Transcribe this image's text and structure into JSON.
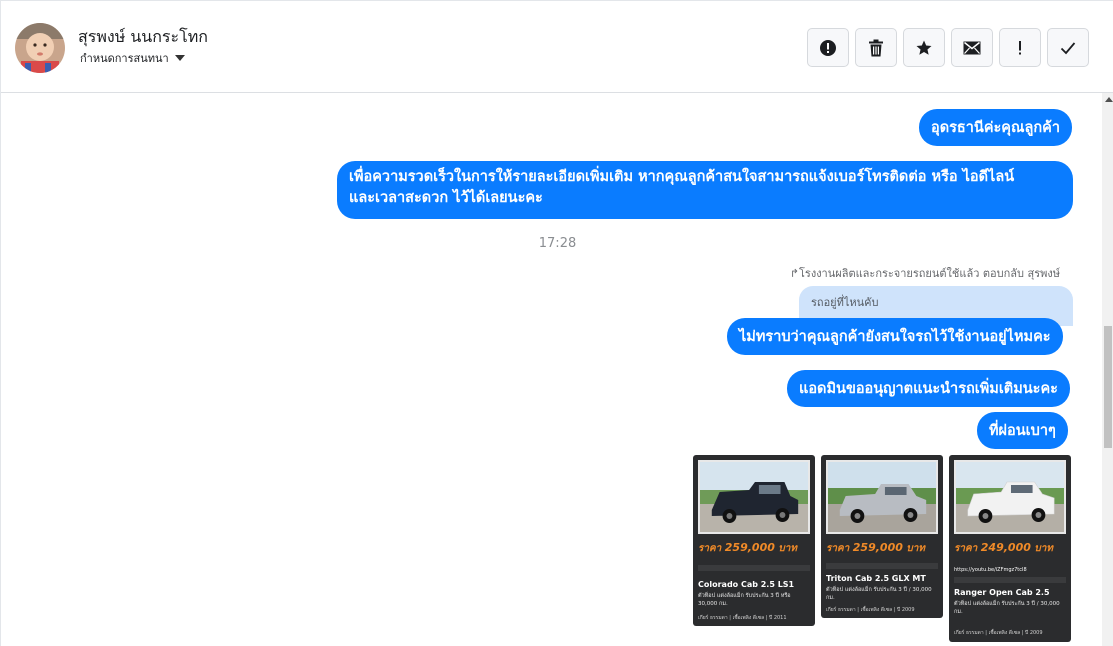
{
  "contact": {
    "name": "สุรพงษ์ นนกระโทก",
    "tag_label": "กำหนดการสนทนา"
  },
  "actions": [
    {
      "name": "spam-button",
      "icon": "exclamation-circle-icon"
    },
    {
      "name": "delete-button",
      "icon": "trash-icon"
    },
    {
      "name": "star-button",
      "icon": "star-icon"
    },
    {
      "name": "mark-unread-button",
      "icon": "envelope-icon"
    },
    {
      "name": "important-button",
      "icon": "exclamation-icon"
    },
    {
      "name": "done-button",
      "icon": "check-icon"
    }
  ],
  "messages": {
    "m1": "อุดรธานีค่ะคุณลูกค้า",
    "m2_line1": "เพื่อความรวดเร็วในการให้รายละเอียดเพิ่มเติม หากคุณลูกค้าสนใจสามารถแจ้งเบอร์โทรติดต่อ หรือ ไอดีไลน์",
    "m2_line2": "และเวลาสะดวก ไว้ได้เลยนะคะ",
    "timestamp": "17:28",
    "reply_note": "โรงงานผลิตและกระจายรถยนต์ใช้แล้ว ตอบกลับ สุรพงษ์",
    "reply_quote": "รถอยู่ที่ไหนคับ",
    "m3": "ไม่ทราบว่าคุณลูกค้ายังสนใจรถไว้ใช้งานอยู่ไหมคะ",
    "m4": "แอดมินขออนุญาตแนะนำรถเพิ่มเติมนะคะ",
    "m5": "ที่ผ่อนเบาๆ"
  },
  "cars": [
    {
      "price_prefix": "ราคา",
      "price": "259,000",
      "price_unit": "บาท",
      "model": "Colorado Cab 2.5 LS1",
      "desc": "ตัวท็อป แต่งล้อแม็ก รับประกัน 3 ปี หรือ 30,000 กม.",
      "foot": "เกียร์ ธรรมดา  |  เชื้อเพลิง ดีเซล  |  ปี 2011",
      "body_color": "#1f2530"
    },
    {
      "price_prefix": "ราคา",
      "price": "259,000",
      "price_unit": "บาท",
      "model": "Triton Cab 2.5 GLX MT",
      "desc": "ตัวท็อป แต่งล้อแม็ก รับประกัน 3 ปี / 30,000 กม.",
      "foot": "เกียร์ ธรรมดา  |  เชื้อเพลิง ดีเซล  |  ปี 2009",
      "body_color": "#b8bcc2"
    },
    {
      "price_prefix": "ราคา",
      "price": "249,000",
      "price_unit": "บาท",
      "model": "Ranger Open Cab 2.5",
      "link": "https://youtu.be/iZFmgz7tcI8",
      "desc": "ตัวท็อป แต่งล้อแม็ก รับประกัน 3 ปี / 30,000 กม.",
      "foot": "เกียร์ ธรรมดา  |  เชื้อเพลิง ดีเซล  |  ปี 2009",
      "body_color": "#f2f2f2"
    }
  ],
  "colors": {
    "bubble": "#0a7cff",
    "quote_bg": "#cfe3fb",
    "price": "#f08a28"
  }
}
